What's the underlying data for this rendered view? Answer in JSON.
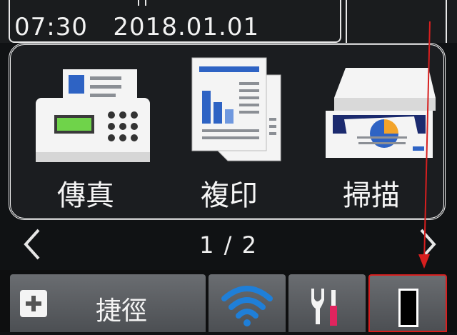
{
  "status": {
    "time": "07:30",
    "date": "2018.01.01"
  },
  "apps": [
    {
      "label": "傳真",
      "icon": "fax-icon"
    },
    {
      "label": "複印",
      "icon": "copy-icon"
    },
    {
      "label": "掃描",
      "icon": "scan-icon"
    }
  ],
  "pager": {
    "indicator": "1 / 2"
  },
  "bottom": {
    "shortcuts_label": "捷徑",
    "wifi_icon": "wifi-icon",
    "tools_icon": "tools-icon",
    "toner_icon": "toner-icon"
  },
  "colors": {
    "background": "#101214",
    "button": "#5c5f63",
    "wifi": "#1f7fd8",
    "highlight": "#d71f1f"
  }
}
